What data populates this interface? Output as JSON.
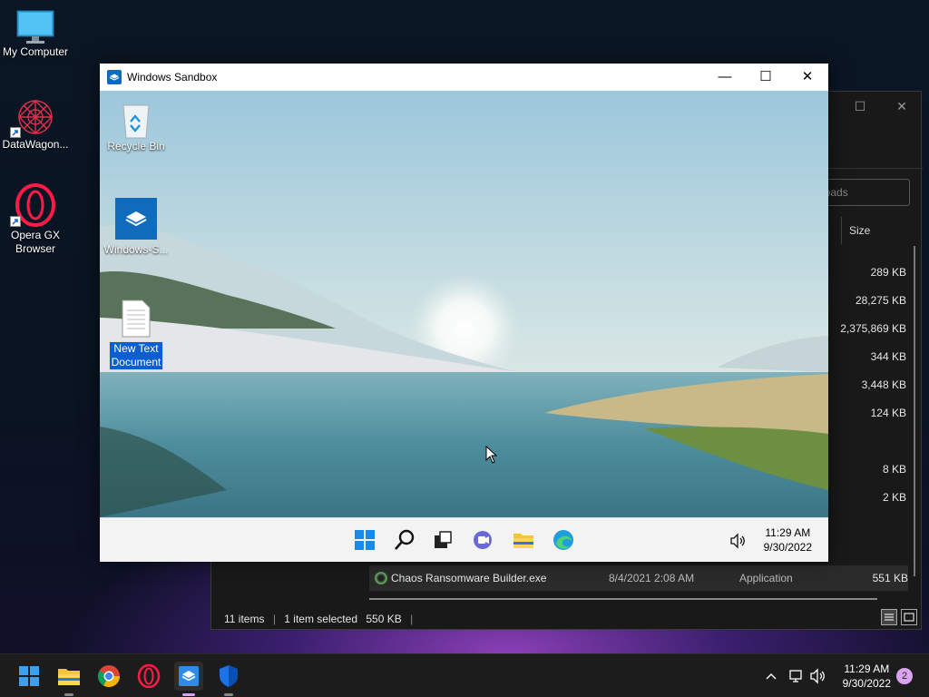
{
  "desktop": {
    "icons": [
      {
        "label": "My Computer"
      },
      {
        "label": "DataWagon..."
      },
      {
        "label": "Opera GX Browser"
      }
    ]
  },
  "explorer": {
    "search_placeholder": "loads",
    "column_size": "Size",
    "sizes": [
      "289 KB",
      "28,275 KB",
      "2,375,869 KB",
      "344 KB",
      "3,448 KB",
      "124 KB",
      "8 KB",
      "2 KB"
    ],
    "selected_row": {
      "name": "Chaos Ransomware Builder.exe",
      "date": "8/4/2021 2:08 AM",
      "type": "Application",
      "size": "551 KB"
    },
    "status": {
      "items": "11 items",
      "selected": "1 item selected",
      "selected_size": "550 KB"
    }
  },
  "sandbox": {
    "title": "Windows Sandbox",
    "icons": [
      {
        "label": "Recycle Bin"
      },
      {
        "label": "Windows-S..."
      },
      {
        "label": "New Text Document"
      }
    ],
    "clock": {
      "time": "11:29 AM",
      "date": "9/30/2022"
    }
  },
  "taskbar": {
    "clock": {
      "time": "11:29 AM",
      "date": "9/30/2022"
    },
    "notification_count": "2"
  }
}
